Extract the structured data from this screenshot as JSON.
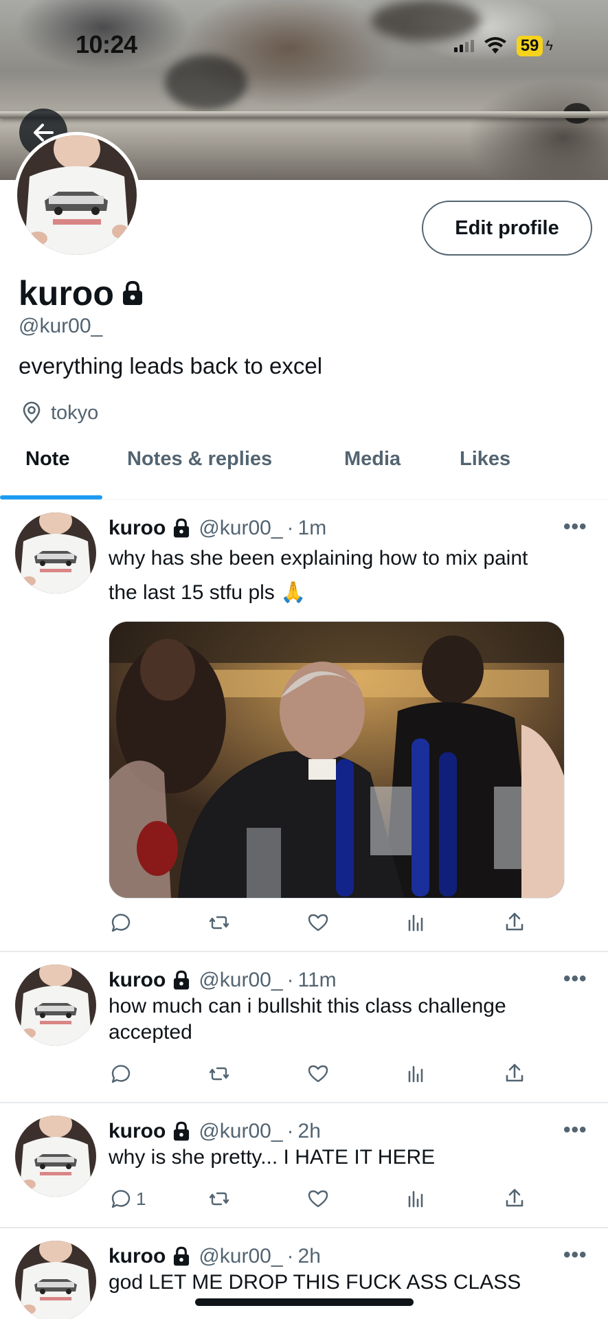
{
  "status_bar": {
    "time": "10:24",
    "battery": "59"
  },
  "profile": {
    "display_name": "kuroo",
    "handle": "@kur00_",
    "bio": "everything leads back to excel",
    "location": "tokyo",
    "edit_button_label": "Edit profile",
    "locked": true
  },
  "icons": {
    "back": "arrow-left-icon",
    "lock": "lock-icon",
    "location": "location-pin-icon",
    "reply": "reply-icon",
    "repost": "repost-icon",
    "like": "heart-icon",
    "views": "views-icon",
    "share": "share-icon",
    "more": "more-icon"
  },
  "tabs": [
    {
      "label": "Note",
      "active": true
    },
    {
      "label": "Notes & replies",
      "active": false
    },
    {
      "label": "Media",
      "active": false
    },
    {
      "label": "Likes",
      "active": false
    }
  ],
  "colors": {
    "accent": "#1d9bf0",
    "secondary_text": "#536471",
    "battery": "#f5d31c"
  },
  "posts": [
    {
      "name": "kuroo",
      "handle": "@kur00_",
      "separator": "·",
      "time": "1m",
      "more": "•••",
      "text_line1": "why has she been explaining how to mix paint",
      "text_line2": "the last 15 stfu pls 🙏",
      "has_media": true,
      "reply_count": ""
    },
    {
      "name": "kuroo",
      "handle": "@kur00_",
      "separator": "·",
      "time": "11m",
      "more": "•••",
      "text_line1": "how much can i bullshit this class challenge",
      "text_line2": "accepted",
      "has_media": false,
      "reply_count": ""
    },
    {
      "name": "kuroo",
      "handle": "@kur00_",
      "separator": "·",
      "time": "2h",
      "more": "•••",
      "text_line1": "why is she pretty... I HATE IT HERE",
      "has_media": false,
      "reply_count": "1"
    },
    {
      "name": "kuroo",
      "handle": "@kur00_",
      "separator": "·",
      "time": "2h",
      "more": "•••",
      "text_line1": "god LET ME DROP THIS FUCK ASS CLASS",
      "has_media": false,
      "reply_count": ""
    }
  ]
}
